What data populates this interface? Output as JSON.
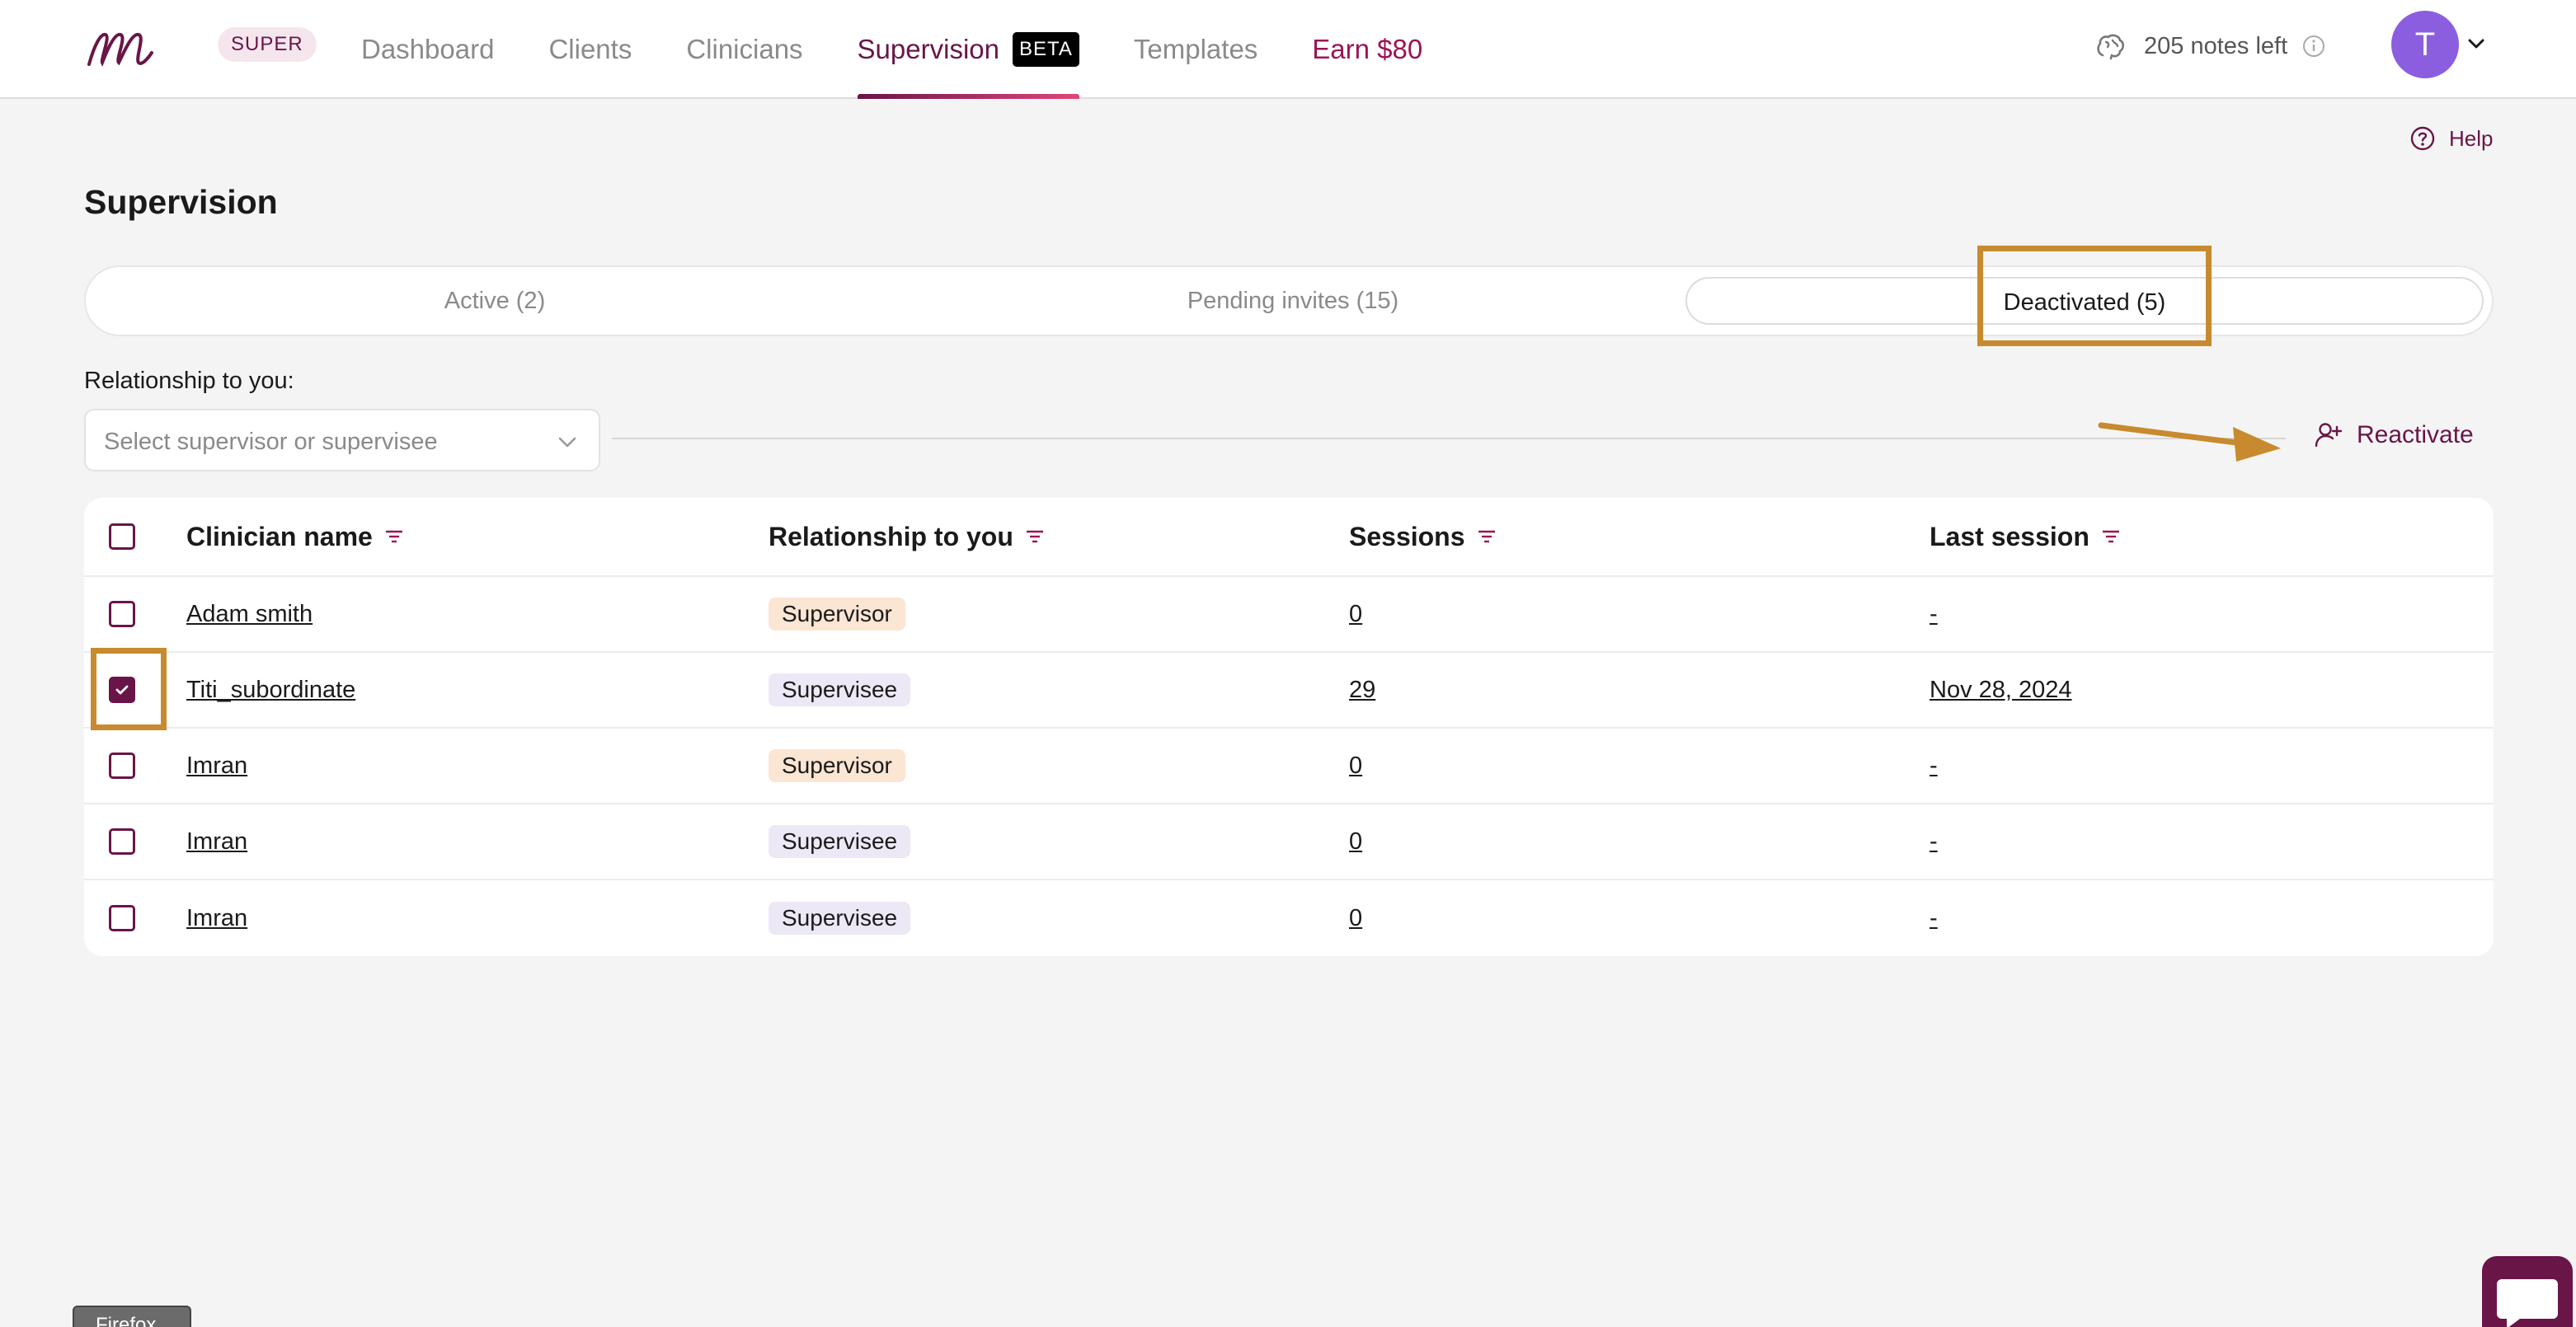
{
  "header": {
    "badge": "SUPER",
    "nav": [
      {
        "label": "Dashboard"
      },
      {
        "label": "Clients"
      },
      {
        "label": "Clinicians"
      },
      {
        "label": "Supervision",
        "badge": "BETA",
        "active": true
      },
      {
        "label": "Templates"
      },
      {
        "label": "Earn $80"
      }
    ],
    "notes_left": "205 notes left",
    "avatar_initial": "T"
  },
  "help_label": "Help",
  "page_title": "Supervision",
  "tabs": [
    {
      "label": "Active (2)"
    },
    {
      "label": "Pending invites (15)"
    },
    {
      "label": "Deactivated (5)",
      "selected": true
    }
  ],
  "filter": {
    "label": "Relationship to you:",
    "placeholder": "Select supervisor or supervisee"
  },
  "reactivate_label": "Reactivate",
  "table": {
    "columns": [
      "Clinician name",
      "Relationship to you",
      "Sessions",
      "Last session"
    ],
    "rows": [
      {
        "name": "Adam smith",
        "relationship": "Supervisor",
        "sessions": "0",
        "last_session": "-",
        "checked": false
      },
      {
        "name": "Titi_subordinate",
        "relationship": "Supervisee",
        "sessions": "29",
        "last_session": "Nov 28, 2024",
        "checked": true
      },
      {
        "name": "Imran",
        "relationship": "Supervisor",
        "sessions": "0",
        "last_session": "-",
        "checked": false
      },
      {
        "name": "Imran",
        "relationship": "Supervisee",
        "sessions": "0",
        "last_session": "-",
        "checked": false
      },
      {
        "name": "Imran",
        "relationship": "Supervisee",
        "sessions": "0",
        "last_session": "-",
        "checked": false
      }
    ]
  },
  "browser_tag": "Firefox",
  "colors": {
    "brand": "#6a1547",
    "annotation": "#c88a2e",
    "supervisor_pill": "#fbe5d3",
    "supervisee_pill": "#ece8f6",
    "avatar": "#8b5ee0"
  }
}
